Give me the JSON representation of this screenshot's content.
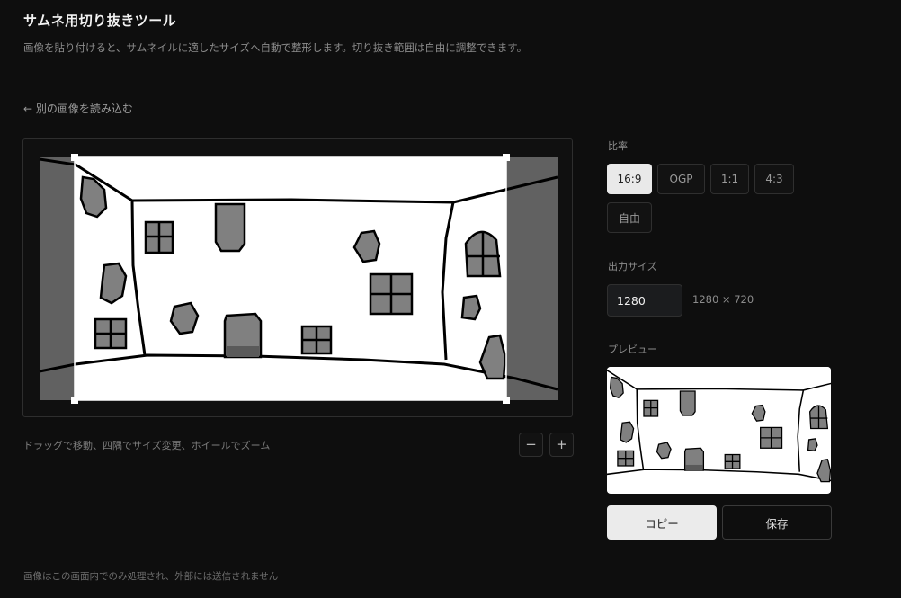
{
  "header": {
    "title": "サムネ用切り抜きツール",
    "subtitle": "画像を貼り付けると、サムネイルに適したサイズへ自動で整形します。切り抜き範囲は自由に調整できます。"
  },
  "back_link": "← 別の画像を読み込む",
  "crop": {
    "hint": "ドラッグで移動、四隅でサイズ変更、ホイールでズーム",
    "zoom_out": "−",
    "zoom_in": "+"
  },
  "ratio": {
    "label": "比率",
    "options": [
      "16:9",
      "OGP",
      "1:1",
      "4:3",
      "自由"
    ],
    "selected": "16:9"
  },
  "output": {
    "label": "出力サイズ",
    "width_value": "1280",
    "readout": "1280 × 720"
  },
  "preview": {
    "label": "プレビュー"
  },
  "actions": {
    "copy": "コピー",
    "save": "保存"
  },
  "footer": "画像はこの画面内でのみ処理され、外部には送信されません",
  "colors": {
    "background": "#0e0e0e",
    "accent_button": "#e9e9e9",
    "drawing_gray": "#808080"
  }
}
